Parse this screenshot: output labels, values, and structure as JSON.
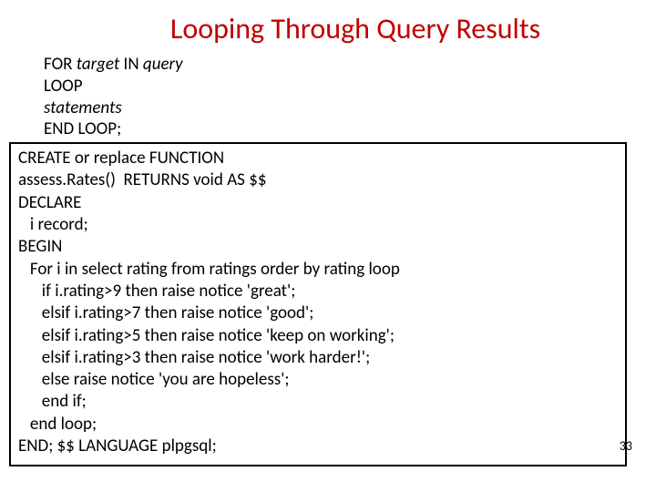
{
  "title": "Looping Through Query Results",
  "syntax": {
    "line1_prefix": "FOR ",
    "line1_target": "target",
    "line1_in": "  IN  ",
    "line1_query": "query",
    "line2": "LOOP",
    "line3": "statements",
    "line4": "END LOOP;"
  },
  "code": {
    "l1": "CREATE or replace FUNCTION",
    "l2": "assess.Rates()  RETURNS void AS $$",
    "l3": "DECLARE",
    "l4": "   i record;",
    "l5": "BEGIN",
    "l6": "   For i in select rating from ratings order by rating loop",
    "l7": "      if i.rating>9 then raise notice 'great';",
    "l8": "      elsif i.rating>7 then raise notice 'good';",
    "l9": "      elsif i.rating>5 then raise notice 'keep on working';",
    "l10": "      elsif i.rating>3 then raise notice 'work harder!';",
    "l11": "      else raise notice 'you are hopeless';",
    "l12": "      end if;",
    "l13": "   end loop;",
    "l14": "END; $$ LANGUAGE plpgsql;"
  },
  "page_number": "33"
}
